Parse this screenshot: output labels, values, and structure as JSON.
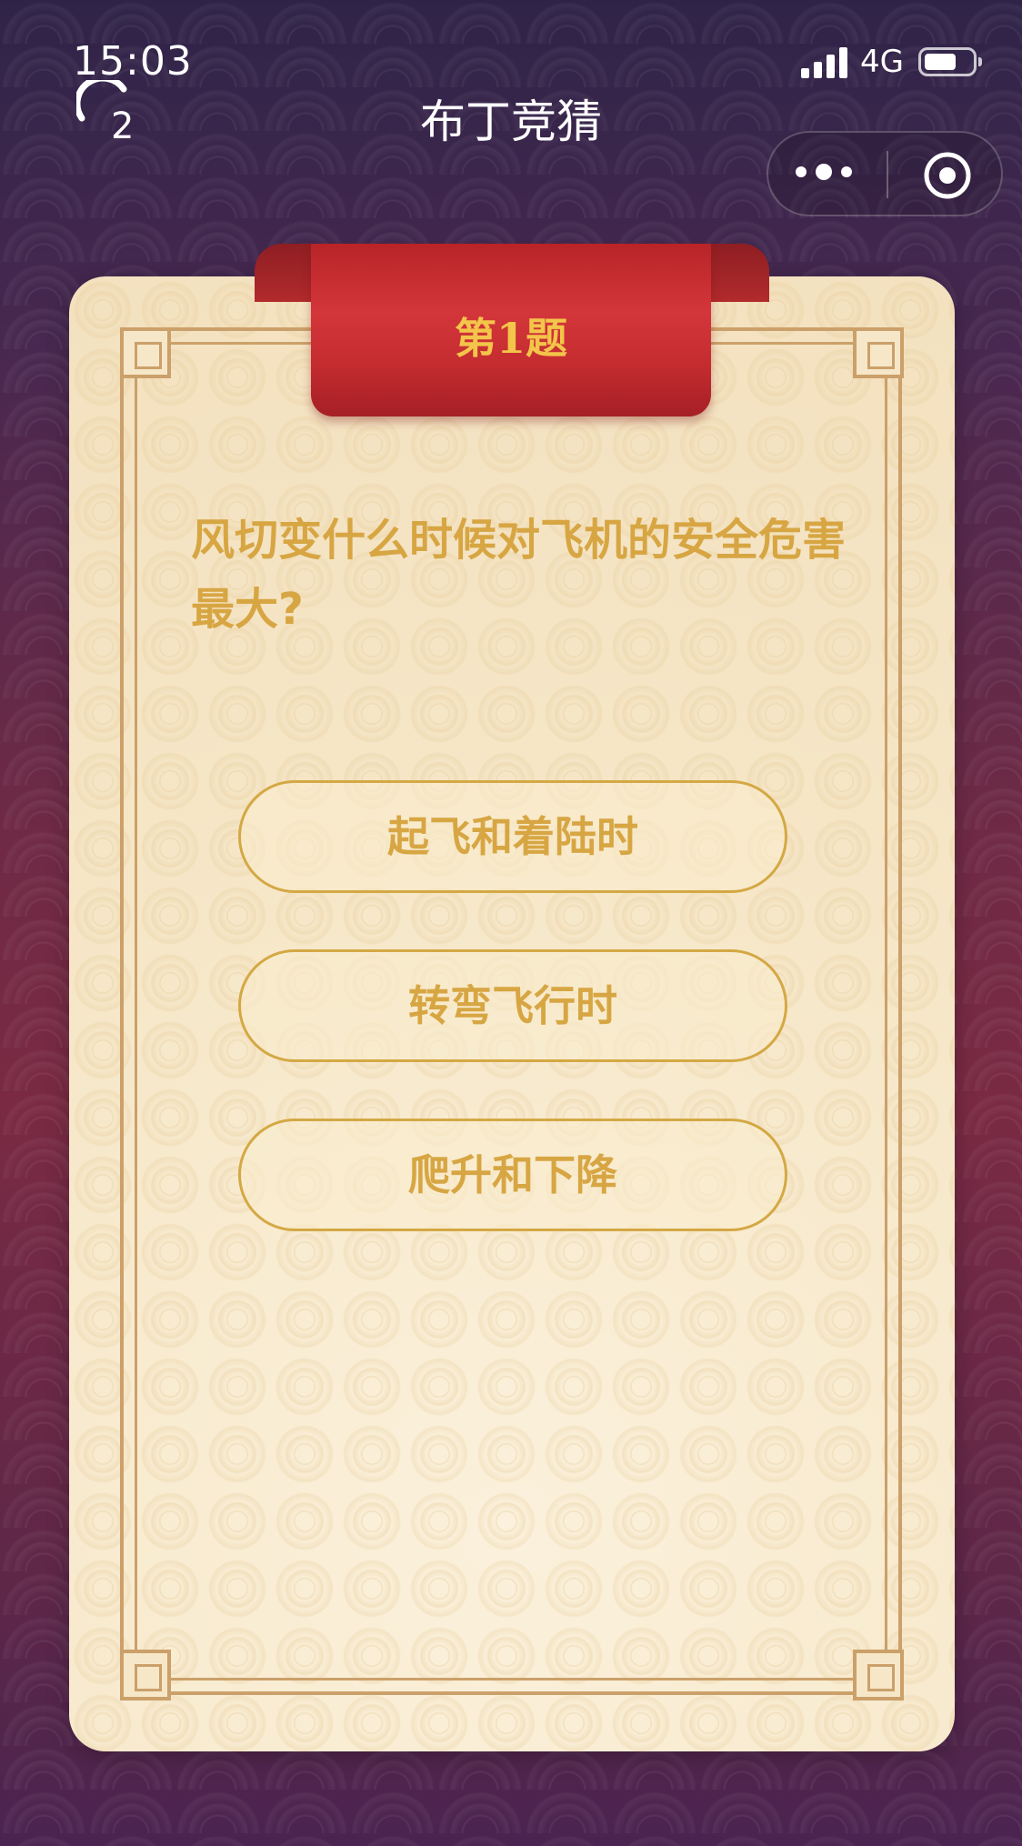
{
  "status_bar": {
    "time": "15:03",
    "network": "4G",
    "battery_level": 0.65,
    "icons": [
      "signal-icon",
      "battery-icon"
    ]
  },
  "nav": {
    "back_count": "2",
    "title": "布丁竞猜",
    "icons": [
      "refresh-icon",
      "more-icon",
      "close-icon"
    ]
  },
  "quiz": {
    "question_label": "第1题",
    "question": "风切变什么时候对飞机的安全危害最大?",
    "options": [
      {
        "label": "起飞和着陆时"
      },
      {
        "label": "转弯飞行时"
      },
      {
        "label": "爬升和下降"
      }
    ]
  },
  "colors": {
    "ribbon": "#d3363a",
    "ribbon_text": "#f3c54a",
    "gold_text": "#d7a643",
    "card_background": "#f7ead0",
    "frame": "#cba06a",
    "page_background": "#6f2a45"
  }
}
